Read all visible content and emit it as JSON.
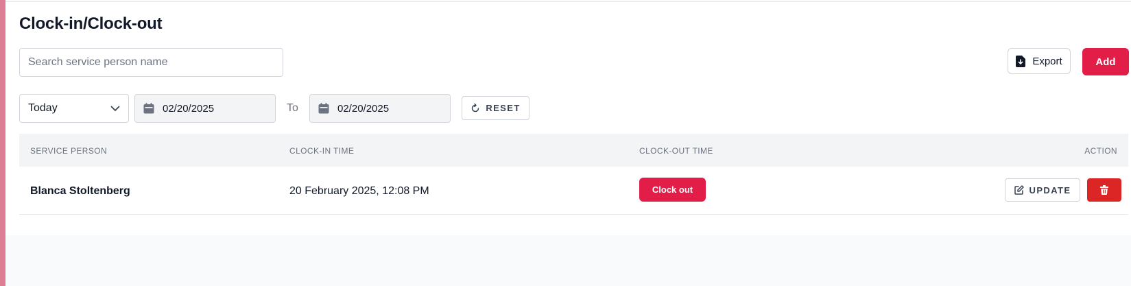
{
  "page": {
    "title": "Clock-in/Clock-out"
  },
  "toolbar": {
    "search_placeholder": "Search service person name",
    "search_value": "",
    "export_label": "Export",
    "add_label": "Add"
  },
  "filters": {
    "range_selected": "Today",
    "date_from": "02/20/2025",
    "to_label": "To",
    "date_to": "02/20/2025",
    "reset_label": "RESET"
  },
  "table": {
    "columns": [
      "SERVICE PERSON",
      "CLOCK-IN TIME",
      "CLOCK-OUT TIME",
      "ACTION"
    ],
    "rows": [
      {
        "service_person": "Blanca Stoltenberg",
        "clock_in_time": "20 February 2025, 12:08 PM",
        "clock_out_label": "Clock out",
        "update_label": "UPDATE"
      }
    ]
  },
  "icons": {
    "export": "file-download-icon",
    "dropdown": "chevron-down-icon",
    "calendar": "calendar-icon",
    "reset": "refresh-icon",
    "update": "edit-icon",
    "delete": "trash-icon"
  },
  "colors": {
    "accent": "#e11d48",
    "danger": "#dc2626",
    "sidebar_accent": "#dc7f94"
  }
}
